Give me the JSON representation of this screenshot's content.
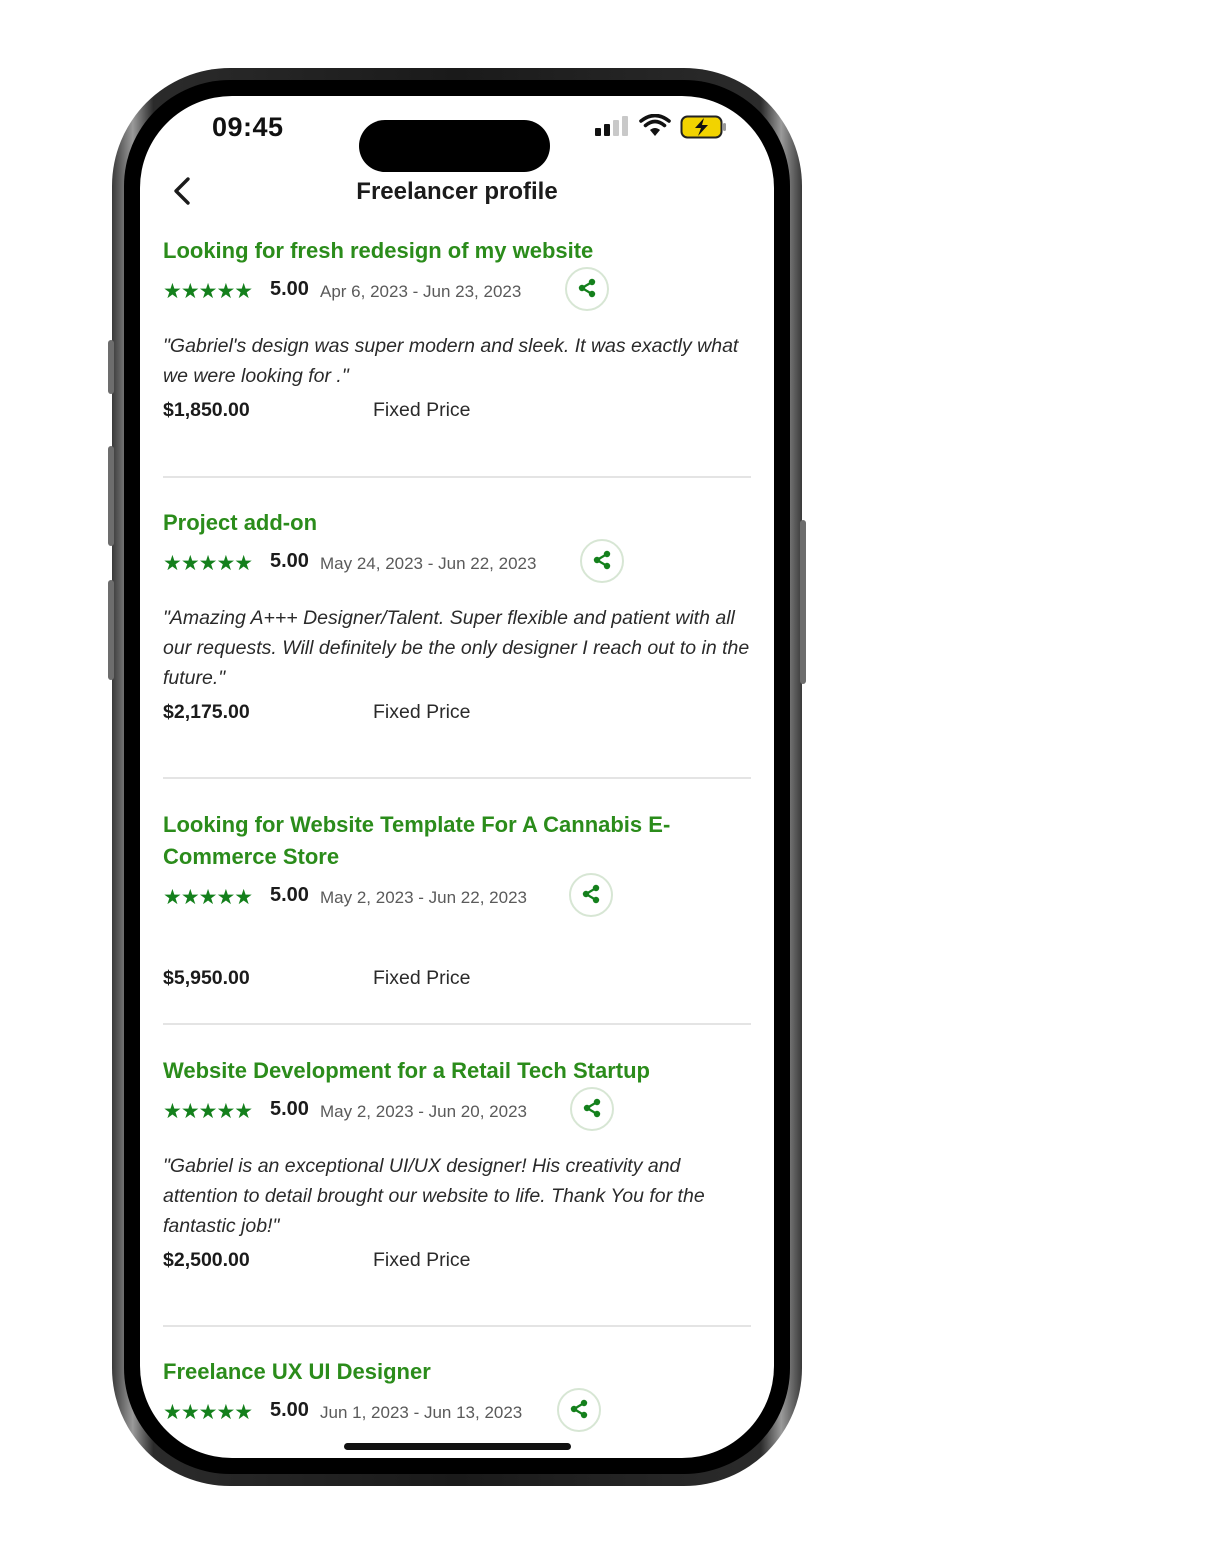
{
  "status_bar": {
    "time": "09:45"
  },
  "header": {
    "title": "Freelancer profile"
  },
  "jobs": [
    {
      "title": "Looking for fresh redesign of my website",
      "stars": "★★★★★",
      "score": "5.00",
      "dates": "Apr 6, 2023 - Jun 23, 2023",
      "quote": "\"Gabriel's design was super modern and sleek. It was exactly what we were looking for .\"",
      "price": "$1,850.00",
      "price_type": "Fixed Price"
    },
    {
      "title": "Project add-on",
      "stars": "★★★★★",
      "score": "5.00",
      "dates": "May 24, 2023 - Jun 22, 2023",
      "quote": "\"Amazing A+++ Designer/Talent. Super flexible and patient with all our requests. Will definitely be the only designer I reach out to in the future.\"",
      "price": "$2,175.00",
      "price_type": "Fixed Price"
    },
    {
      "title": "Looking for Website Template For A Cannabis E-Commerce Store",
      "stars": "★★★★★",
      "score": "5.00",
      "dates": "May 2, 2023 - Jun 22, 2023",
      "quote": "",
      "price": "$5,950.00",
      "price_type": "Fixed Price"
    },
    {
      "title": "Website Development for a Retail Tech Startup",
      "stars": "★★★★★",
      "score": "5.00",
      "dates": "May 2, 2023 - Jun 20, 2023",
      "quote": "\"Gabriel is an exceptional UI/UX designer! His creativity and attention to detail brought our website to life. Thank You for the fantastic job!\"",
      "price": "$2,500.00",
      "price_type": "Fixed Price"
    },
    {
      "title": "Freelance UX UI Designer",
      "stars": "★★★★★",
      "score": "5.00",
      "dates": "Jun 1, 2023 - Jun 13, 2023"
    }
  ],
  "rating_value": 5,
  "colors": {
    "accent_green": "#2b8c1b",
    "star_green": "#14801c",
    "battery_yellow": "#f2d300"
  },
  "icons": {
    "back": "chevron-left-icon",
    "share": "share-icon",
    "wifi": "wifi-icon",
    "signal": "cellular-signal-icon",
    "battery": "battery-charging-icon"
  }
}
